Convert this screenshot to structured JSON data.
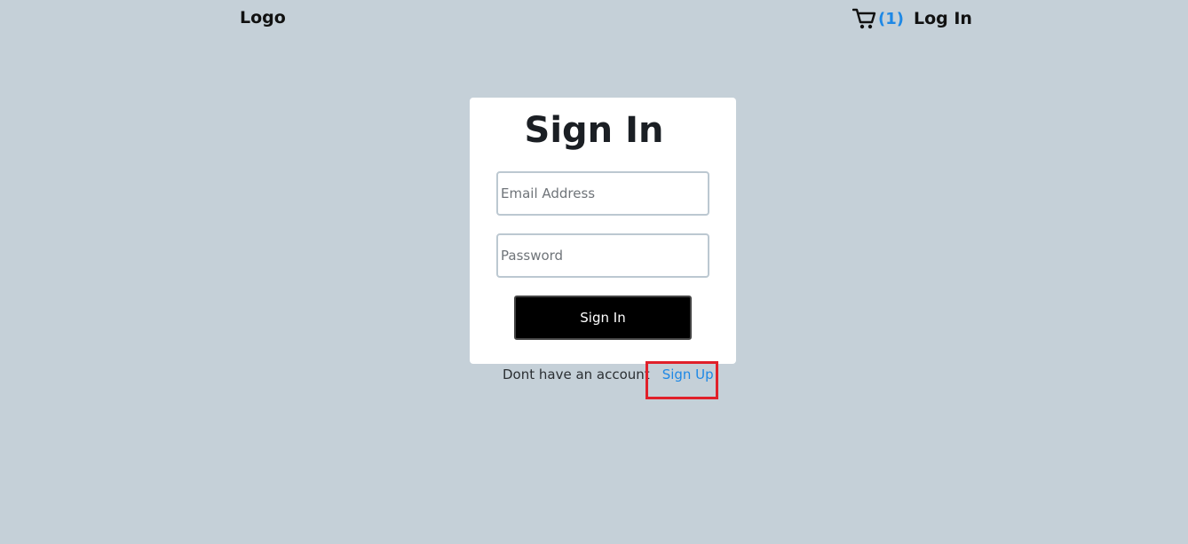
{
  "header": {
    "logo": "Logo",
    "cart_icon": "cart-icon",
    "cart_count": "(1)",
    "login_label": "Log In"
  },
  "signin_form": {
    "title": "Sign In",
    "email_placeholder": "Email Address",
    "email_value": "",
    "password_placeholder": "Password",
    "password_value": "",
    "submit_label": "Sign In"
  },
  "signup_prompt": {
    "text": "Dont have an account",
    "link_label": "Sign Up"
  },
  "colors": {
    "background": "#c5d0d8",
    "accent": "#1e88e5",
    "highlight": "#e0202a"
  }
}
